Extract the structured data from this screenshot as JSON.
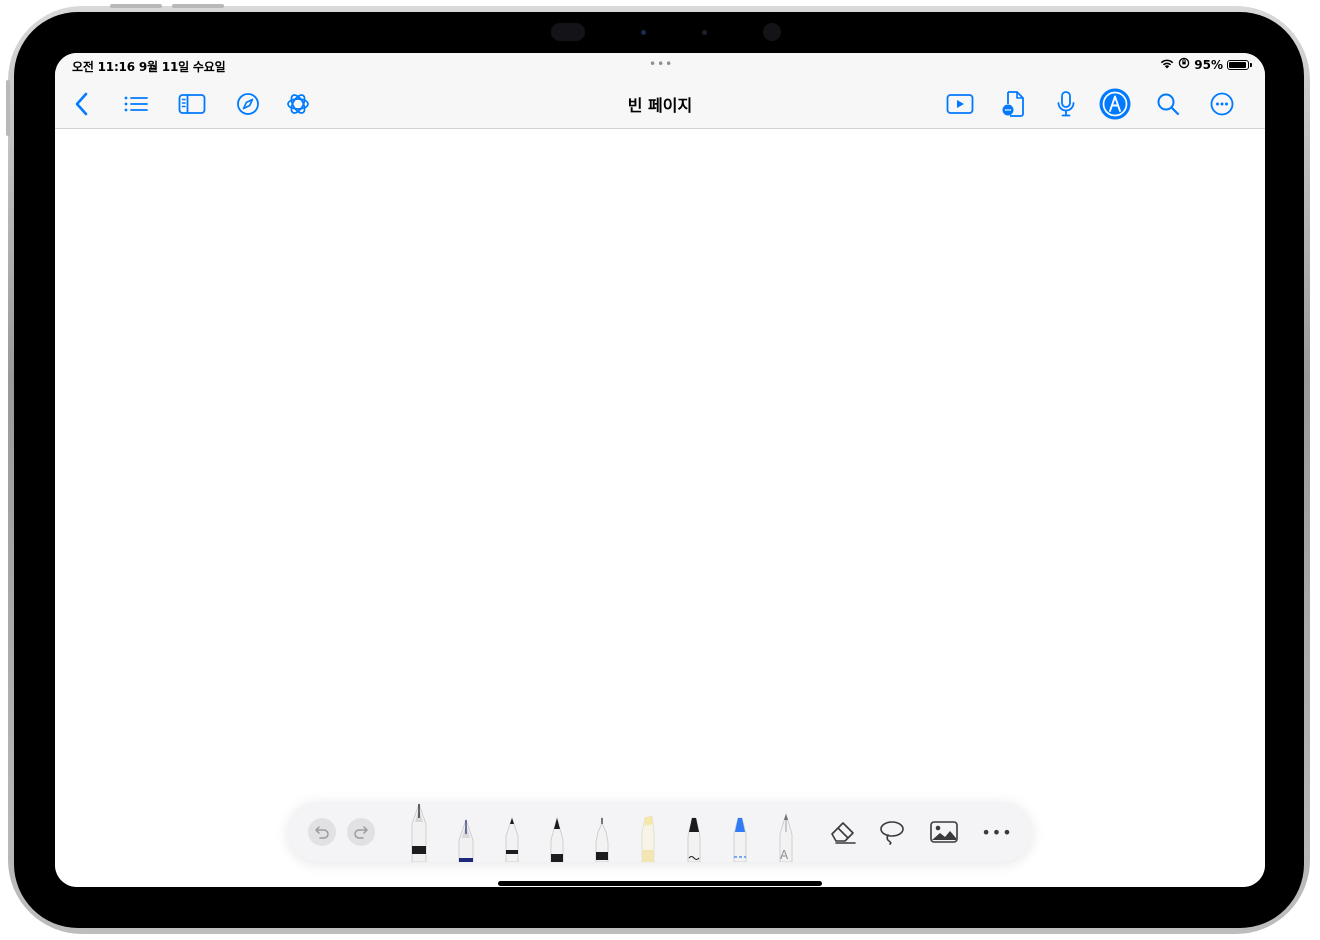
{
  "status_bar": {
    "time": "오전 11:16  9월 11일 수요일",
    "multitask_dots": "•••",
    "battery_percent": "95%",
    "battery_level": 0.95
  },
  "nav": {
    "title": "빈 페이지",
    "left_icons": [
      "chevron-left-icon",
      "list-icon",
      "sidebar-icon",
      "compass-icon",
      "chatgpt-icon"
    ],
    "right_icons": [
      "play-icon",
      "document-icon",
      "microphone-icon",
      "pencil-circle-icon",
      "search-icon",
      "more-circle-icon"
    ]
  },
  "colors": {
    "accent": "#007aff",
    "nav_background": "#f7f7f7",
    "toolbar_background": "#f4f4f6"
  },
  "toolbar": {
    "tools": [
      "fountain-pen-black",
      "fountain-pen-navy",
      "ballpoint-pen",
      "brush-pen",
      "fineliner",
      "highlighter",
      "marker-squiggle",
      "marker-blue-dashed",
      "text-pencil"
    ],
    "text_tool_letter": "A",
    "more_label": "•••"
  }
}
